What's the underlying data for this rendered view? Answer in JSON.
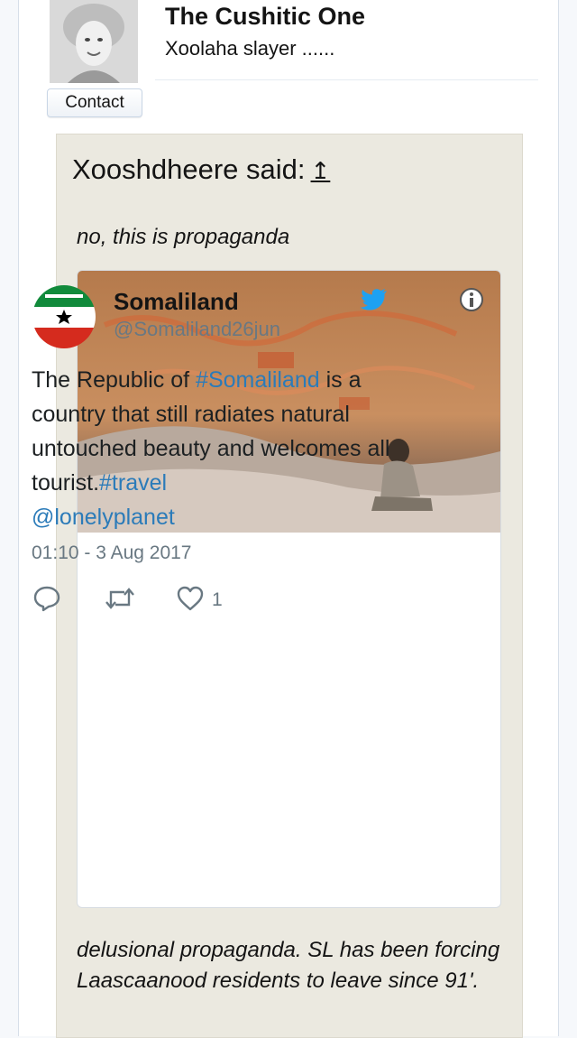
{
  "post": {
    "username": "The Cushitic One",
    "user_title": "Xoolaha slayer ......",
    "contact_label": "Contact",
    "avatar_icon": "user-avatar-photo"
  },
  "quote": {
    "author_line": "Xooshdheere said:",
    "jump_icon": "↥",
    "text_before": "no, this is propaganda",
    "text_after": "delusional propaganda. SL has been forcing Laascaanood residents to leave since 91'."
  },
  "tweet": {
    "display_name": "Somaliland",
    "handle": "@Somaliland26jun",
    "body_plain1": "The Republic of ",
    "hashtag1": "#Somaliland",
    "body_plain2": " is a country that still radiates natural untouched beauty and welcomes all tourist.",
    "hashtag2": "#travel",
    "mention": "@lonelyplanet",
    "timestamp": "01:10 - 3 Aug 2017",
    "like_count": "1",
    "link_color": "#2b7bb9",
    "icons": [
      "info-icon",
      "twitter-bird-icon",
      "reply-icon",
      "retweet-icon",
      "like-icon"
    ]
  }
}
